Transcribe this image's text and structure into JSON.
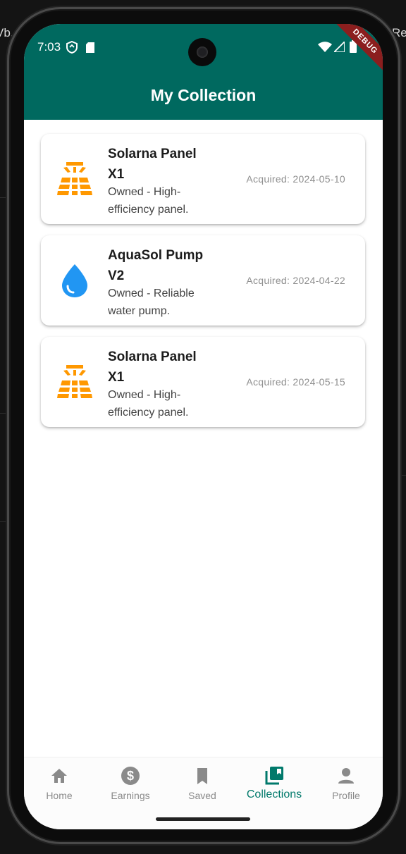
{
  "status_bar": {
    "time": "7:03"
  },
  "debug_banner": "DEBUG",
  "app_bar": {
    "title": "My Collection"
  },
  "items": [
    {
      "name": "Solarna Panel X1",
      "description": "Owned - High-efficiency panel.",
      "acquired": "Acquired: 2024-05-10",
      "icon": "solar-panel-icon",
      "icon_color": "#FF9800"
    },
    {
      "name": "AquaSol Pump V2",
      "description": "Owned - Reliable water pump.",
      "acquired": "Acquired: 2024-04-22",
      "icon": "water-drop-icon",
      "icon_color": "#2196F3"
    },
    {
      "name": "Solarna Panel X1",
      "description": "Owned - High-efficiency panel.",
      "acquired": "Acquired: 2024-05-15",
      "icon": "solar-panel-icon",
      "icon_color": "#FF9800"
    }
  ],
  "bottom_nav": {
    "active_color": "#00796B",
    "items": [
      {
        "label": "Home",
        "icon": "home-icon"
      },
      {
        "label": "Earnings",
        "icon": "dollar-icon"
      },
      {
        "label": "Saved",
        "icon": "bookmark-icon"
      },
      {
        "label": "Collections",
        "icon": "collections-icon",
        "active": true
      },
      {
        "label": "Profile",
        "icon": "person-icon"
      }
    ]
  },
  "background_fragments": [
    "Vb..",
    "Re"
  ]
}
